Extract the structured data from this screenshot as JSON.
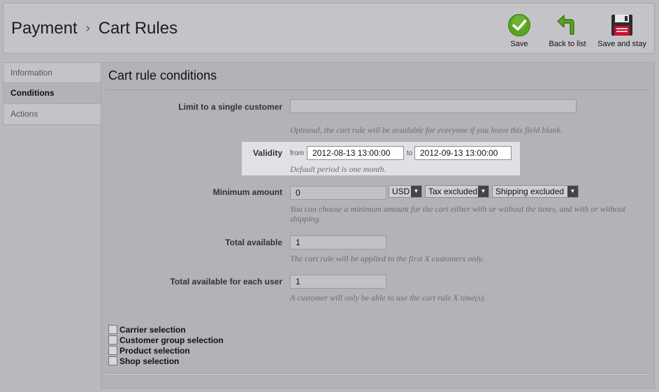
{
  "header": {
    "breadcrumb_parent": "Payment",
    "breadcrumb_separator": "›",
    "breadcrumb_current": "Cart Rules",
    "buttons": {
      "save": {
        "label": "Save",
        "icon": "check-circle-icon"
      },
      "back": {
        "label": "Back to list",
        "icon": "back-arrow-icon"
      },
      "save_stay": {
        "label": "Save and stay",
        "icon": "floppy-disk-icon"
      }
    }
  },
  "tabs": [
    {
      "label": "Information",
      "active": false
    },
    {
      "label": "Conditions",
      "active": true
    },
    {
      "label": "Actions",
      "active": false
    }
  ],
  "panel": {
    "title": "Cart rule conditions",
    "limit_customer": {
      "label": "Limit to a single customer",
      "value": "",
      "hint": "Optional, the cart rule will be available for everyone if you leave this field blank."
    },
    "validity": {
      "label": "Validity",
      "from_label": "from",
      "from_value": "2012-08-13 13:00:00",
      "to_label": "to",
      "to_value": "2012-09-13 13:00:00",
      "hint": "Default period is one month."
    },
    "minimum_amount": {
      "label": "Minimum amount",
      "value": "0",
      "currency": "USD",
      "tax": "Tax excluded",
      "shipping": "Shipping excluded",
      "hint": "You can choose a minimum amount for the cart either with or without the taxes, and with or without shipping."
    },
    "total_available": {
      "label": "Total available",
      "value": "1",
      "hint": "The cart rule will be applied to the first X customers only."
    },
    "total_each_user": {
      "label": "Total available for each user",
      "value": "1",
      "hint": "A customer will only be able to use the cart rule X time(s)."
    },
    "checkboxes": [
      {
        "label": "Carrier selection",
        "checked": false
      },
      {
        "label": "Customer group selection",
        "checked": false
      },
      {
        "label": "Product selection",
        "checked": false
      },
      {
        "label": "Shop selection",
        "checked": false
      }
    ]
  },
  "colors": {
    "background": "#b9b9bf",
    "save_green": "#5aa423",
    "highlight": "#e0e0e6"
  }
}
